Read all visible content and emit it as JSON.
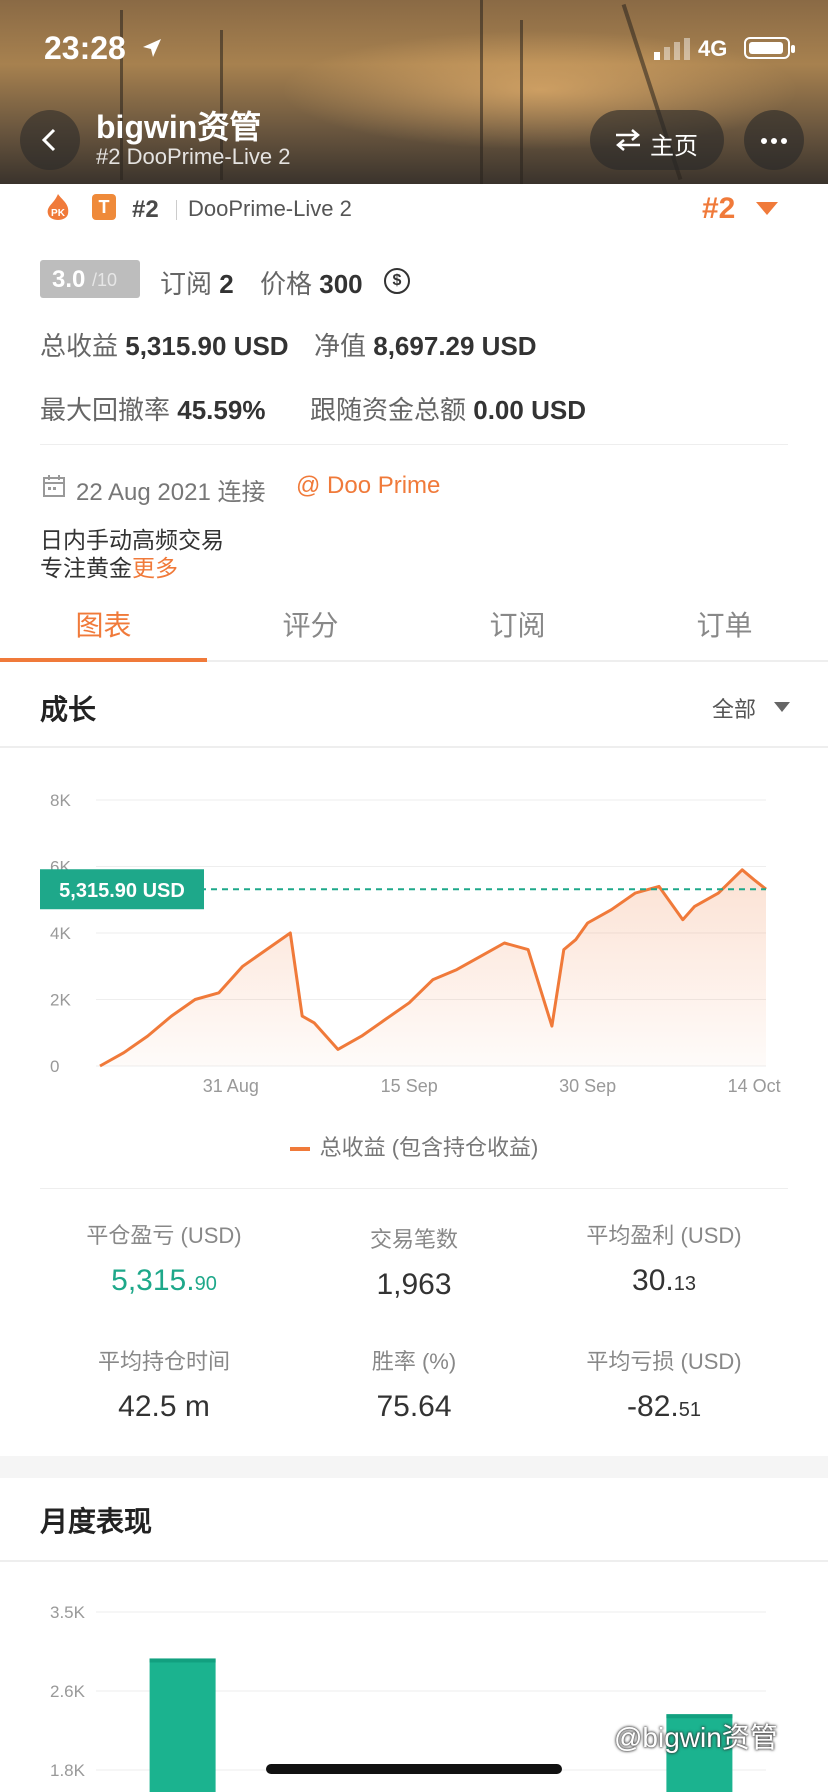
{
  "status_bar": {
    "time": "23:28",
    "network": "4G"
  },
  "header": {
    "title": "bigwin资管",
    "subtitle": "#2 DooPrime-Live 2",
    "home_label": "主页"
  },
  "account": {
    "badge_letter": "T",
    "rank": "#2",
    "name": "DooPrime-Live 2",
    "rank_big": "#2",
    "score": "3.0",
    "score_max": "/10",
    "subscribe_label": "订阅",
    "subscribe_count": "2",
    "price_label": "价格",
    "price": "300",
    "total_profit_label": "总收益",
    "total_profit": "5,315.90 USD",
    "equity_label": "净值",
    "equity": "8,697.29 USD",
    "max_drawdown_label": "最大回撤率",
    "max_drawdown": "45.59%",
    "follow_total_label": "跟随资金总额",
    "follow_total": "0.00 USD",
    "connect_date": "22 Aug 2021 连接",
    "broker": "@ Doo Prime",
    "desc_line1": "日内手动高频交易",
    "desc_line2": "专注黄金",
    "more_link": "更多"
  },
  "tabs": [
    "图表",
    "评分",
    "订阅",
    "订单"
  ],
  "growth": {
    "title": "成长",
    "filter": "全部",
    "current_label": "5,315.90 USD",
    "legend": "总收益 (包含持仓收益)"
  },
  "chart_data": [
    {
      "type": "area",
      "y_ticks": [
        "8K",
        "6K",
        "4K",
        "2K",
        "0"
      ],
      "x_ticks": [
        "31 Aug",
        "15 Sep",
        "30 Sep",
        "14 Oct"
      ],
      "ylim": [
        0,
        8000
      ],
      "series": [
        {
          "name": "总收益 (包含持仓收益)",
          "x": [
            "2021-08-20",
            "2021-08-22",
            "2021-08-24",
            "2021-08-26",
            "2021-08-28",
            "2021-08-30",
            "2021-09-01",
            "2021-09-03",
            "2021-09-05",
            "2021-09-06",
            "2021-09-07",
            "2021-09-09",
            "2021-09-11",
            "2021-09-13",
            "2021-09-15",
            "2021-09-17",
            "2021-09-19",
            "2021-09-21",
            "2021-09-23",
            "2021-09-25",
            "2021-09-27",
            "2021-09-28",
            "2021-09-29",
            "2021-09-30",
            "2021-10-02",
            "2021-10-04",
            "2021-10-06",
            "2021-10-08",
            "2021-10-09",
            "2021-10-11",
            "2021-10-13",
            "2021-10-14",
            "2021-10-15"
          ],
          "values": [
            0,
            400,
            900,
            1500,
            2000,
            2200,
            3000,
            3500,
            4000,
            1500,
            1300,
            500,
            900,
            1400,
            1900,
            2600,
            2900,
            3300,
            3700,
            3500,
            1200,
            3500,
            3800,
            4300,
            4700,
            5200,
            5400,
            4400,
            4800,
            5200,
            5900,
            5600,
            5316
          ]
        }
      ],
      "reference_line": 5315.9
    },
    {
      "type": "bar",
      "y_ticks": [
        "3.5K",
        "2.6K",
        "1.8K"
      ],
      "categories": [
        "",
        "",
        "",
        "",
        ""
      ],
      "values": [
        3000,
        0,
        0,
        0,
        2400
      ]
    }
  ],
  "stats": [
    {
      "label": "平仓盈亏 (USD)",
      "value_main": "5,315.",
      "value_frac": "90",
      "color": "#1ea88a"
    },
    {
      "label": "交易笔数",
      "value_main": "1,963",
      "value_frac": ""
    },
    {
      "label": "平均盈利 (USD)",
      "value_main": "30.",
      "value_frac": "13"
    },
    {
      "label": "平均持仓时间",
      "value_main": "42.5 m",
      "value_frac": ""
    },
    {
      "label": "胜率 (%)",
      "value_main": "75.64",
      "value_frac": ""
    },
    {
      "label": "平均亏损 (USD)",
      "value_main": "-82.",
      "value_frac": "51"
    }
  ],
  "monthly": {
    "title": "月度表现"
  },
  "watermark": "@bigwin资管",
  "colors": {
    "accent": "#f07a3a",
    "green": "#1ea88a"
  }
}
